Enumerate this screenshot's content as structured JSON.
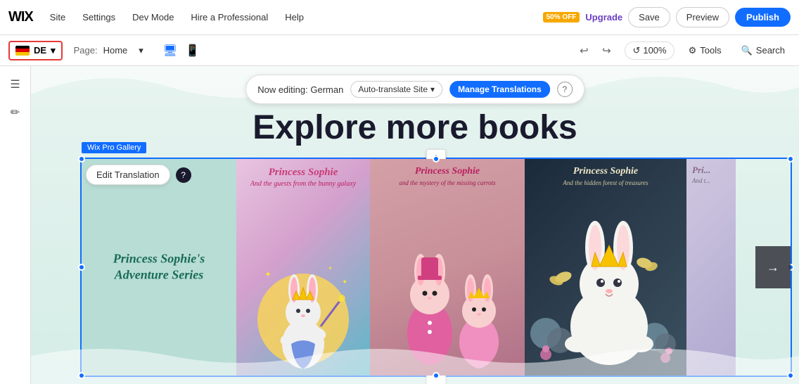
{
  "topbar": {
    "logo": "WIX",
    "nav": [
      "Site",
      "Settings",
      "Dev Mode",
      "Hire a Professional",
      "Help"
    ],
    "badge": "50% OFF",
    "upgrade_label": "Upgrade",
    "save_label": "Save",
    "preview_label": "Preview",
    "publish_label": "Publish"
  },
  "secondbar": {
    "lang_code": "DE",
    "page_label": "Page:",
    "page_name": "Home",
    "undo_icon": "↩",
    "redo_icon": "↪",
    "zoom": "100%",
    "tools_label": "Tools",
    "search_label": "Search"
  },
  "translation_bar": {
    "now_editing": "Now editing: German",
    "auto_translate_label": "Auto-translate Site",
    "manage_translations_label": "Manage Translations",
    "help_char": "?"
  },
  "canvas": {
    "page_title": "Explore more books",
    "gallery_label": "Wix Pro Gallery",
    "edit_translation_label": "Edit Translation",
    "edit_help_char": "?",
    "arrow_char": "→",
    "download_char": "⬇"
  },
  "books": [
    {
      "id": "book1",
      "type": "text",
      "line1": "Princess Sophie's",
      "line2": "Adventure Series",
      "bg_color": "#b8ddd4"
    },
    {
      "id": "book2",
      "type": "image",
      "title": "Princess Sophie",
      "subtitle": "And the guests from the bunny galaxy",
      "bg_start": "#e8c4e0",
      "bg_end": "#7cc8d4"
    },
    {
      "id": "book3",
      "type": "image",
      "title": "Princess Sophie",
      "subtitle": "and the mystery of the missing carrots",
      "bg_color": "#c89098"
    },
    {
      "id": "book4",
      "type": "image",
      "title": "Princess Sophie",
      "subtitle": "And the hidden forest of treasures",
      "bg_color": "#1a2a3a"
    },
    {
      "id": "book5",
      "type": "partial",
      "title": "Pri...",
      "subtitle": "And t..."
    }
  ],
  "sidebar": {
    "icons": [
      "☰",
      "✏"
    ]
  }
}
